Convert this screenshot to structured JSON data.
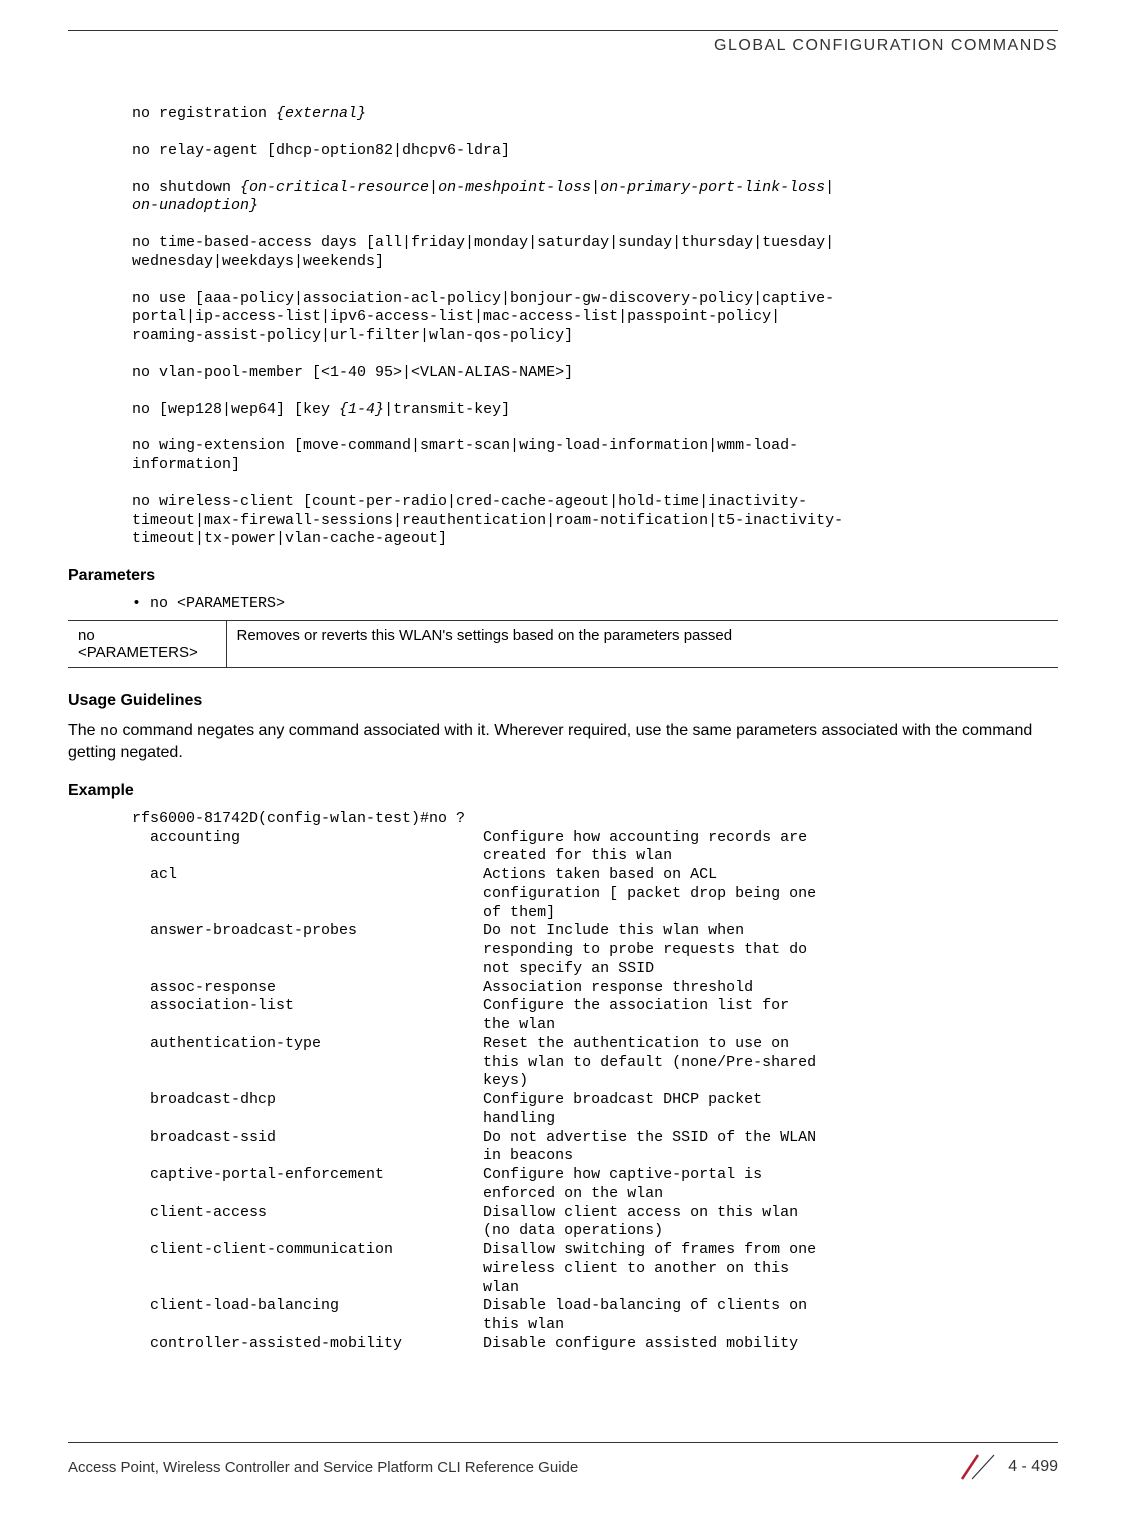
{
  "header": {
    "chapter_title": "GLOBAL CONFIGURATION COMMANDS"
  },
  "code": {
    "l1a": "no registration ",
    "l1b": "{external}",
    "l2": "no relay-agent [dhcp-option82|dhcpv6-ldra]",
    "l3a": "no shutdown ",
    "l3b": "{on-critical-resource|on-meshpoint-loss|on-primary-port-link-loss|\non-unadoption}",
    "l4": "no time-based-access days [all|friday|monday|saturday|sunday|thursday|tuesday|\nwednesday|weekdays|weekends]",
    "l5": "no use [aaa-policy|association-acl-policy|bonjour-gw-discovery-policy|captive-\nportal|ip-access-list|ipv6-access-list|mac-access-list|passpoint-policy|\nroaming-assist-policy|url-filter|wlan-qos-policy]",
    "l6": "no vlan-pool-member [<1-40 95>|<VLAN-ALIAS-NAME>]",
    "l7a": "no [wep128|wep64] [key ",
    "l7b": "{1-4}",
    "l7c": "|transmit-key]",
    "l8": "no wing-extension [move-command|smart-scan|wing-load-information|wmm-load-\ninformation]",
    "l9": "no wireless-client [count-per-radio|cred-cache-ageout|hold-time|inactivity-\ntimeout|max-firewall-sessions|reauthentication|roam-notification|t5-inactivity-\ntimeout|tx-power|vlan-cache-ageout]"
  },
  "sections": {
    "parameters": "Parameters",
    "usage": "Usage Guidelines",
    "example": "Example"
  },
  "param_bullet": "• no <PARAMETERS>",
  "param_table": {
    "left": "no <PARAMETERS>",
    "right": "Removes or reverts this WLAN's settings based on the parameters passed"
  },
  "usage_text_pre": "The ",
  "usage_text_mono": "no",
  "usage_text_post": " command negates any command associated with it. Wherever required, use the same parameters associated with the command getting negated.",
  "example_output": "rfs6000-81742D(config-wlan-test)#no ?\n  accounting                           Configure how accounting records are\n                                       created for this wlan\n  acl                                  Actions taken based on ACL\n                                       configuration [ packet drop being one\n                                       of them]\n  answer-broadcast-probes              Do not Include this wlan when\n                                       responding to probe requests that do\n                                       not specify an SSID\n  assoc-response                       Association response threshold\n  association-list                     Configure the association list for\n                                       the wlan\n  authentication-type                  Reset the authentication to use on\n                                       this wlan to default (none/Pre-shared\n                                       keys)\n  broadcast-dhcp                       Configure broadcast DHCP packet\n                                       handling\n  broadcast-ssid                       Do not advertise the SSID of the WLAN\n                                       in beacons\n  captive-portal-enforcement           Configure how captive-portal is\n                                       enforced on the wlan\n  client-access                        Disallow client access on this wlan\n                                       (no data operations)\n  client-client-communication          Disallow switching of frames from one\n                                       wireless client to another on this\n                                       wlan\n  client-load-balancing                Disable load-balancing of clients on\n                                       this wlan\n  controller-assisted-mobility         Disable configure assisted mobility",
  "footer": {
    "doc_title": "Access Point, Wireless Controller and Service Platform CLI Reference Guide",
    "page_number": "4 - 499"
  }
}
